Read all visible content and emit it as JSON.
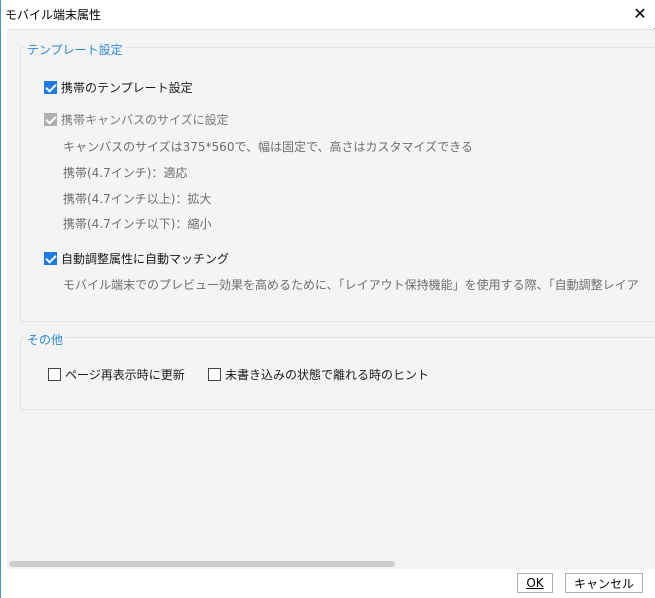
{
  "window": {
    "title": "モバイル端末属性",
    "close_glyph": "✕"
  },
  "template_group": {
    "legend": "テンプレート設定",
    "mobile_template": {
      "label": "携帯のテンプレート設定",
      "checked": true
    },
    "canvas_size": {
      "label": "携帯キャンバスのサイズに設定",
      "checked": true,
      "disabled": true,
      "description": "キャンバスのサイズは375*560で、幅は固定で、高さはカスタマイズできる",
      "options": [
        "携帯(4.7インチ)：適応",
        "携帯(4.7インチ以上)：拡大",
        "携帯(4.7インチ以下)：縮小"
      ]
    },
    "auto_match": {
      "label": "自動調整属性に自動マッチング",
      "checked": true,
      "description": "モバイル端末でのプレビュー効果を高めるために、「レイアウト保持機能」を使用する際、「自動調整レイア"
    }
  },
  "other_group": {
    "legend": "その他",
    "refresh_on_reshow": {
      "label": "ページ再表示時に更新",
      "checked": false
    },
    "unsaved_hint": {
      "label": "未書き込みの状態で離れる時のヒント",
      "checked": false
    }
  },
  "footer": {
    "ok_label": "OK",
    "cancel_label": "キャンセル"
  },
  "colors": {
    "accent": "#1e7ae6",
    "legend": "#2a8bd8",
    "border": "#4a90d9"
  }
}
